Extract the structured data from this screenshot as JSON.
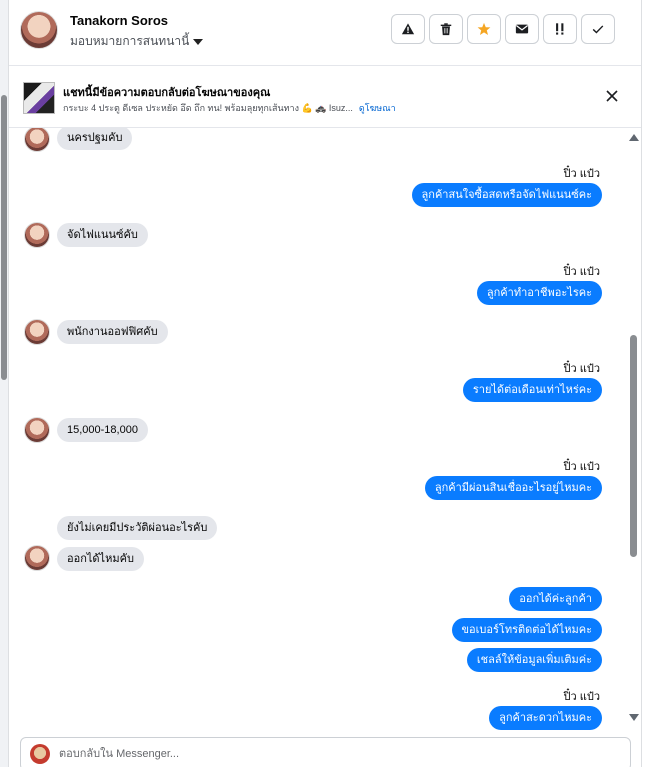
{
  "header": {
    "contact_name": "Tanakorn Soros",
    "assign_label": "มอบหมายการสนทนานี้",
    "actions": [
      {
        "name": "report-spam-button",
        "icon": "warning-icon"
      },
      {
        "name": "delete-button",
        "icon": "trash-icon"
      },
      {
        "name": "star-button",
        "icon": "star-icon"
      },
      {
        "name": "mark-unread-button",
        "icon": "envelope-icon"
      },
      {
        "name": "follow-up-button",
        "icon": "exclamation-icon"
      },
      {
        "name": "mark-done-button",
        "icon": "check-icon"
      }
    ],
    "star_color": "#f5a623"
  },
  "banner": {
    "title": "แชทนี้มีข้อความตอบกลับต่อโฆษณาของคุณ",
    "text": "กระบะ 4 ประตู ดีเซล ประหยัด อึด ถึก ทน! พร้อมลุยทุกเส้นทาง 💪 🚓 Isuz...",
    "link": "ดูโฆษณา"
  },
  "messages": {
    "in_1": "นครปฐมคับ",
    "sender_1": "ปิ๋ว แป๋ว",
    "out_1": "ลูกค้าสนใจซื้อสดหรือจัดไฟแนนซ์คะ",
    "in_2": "จัดไฟแนนซ์คับ",
    "sender_2": "ปิ๋ว แป๋ว",
    "out_2": "ลูกค้าทำอาชีพอะไรคะ",
    "in_3": "พนักงานออฟฟิศคับ",
    "sender_3": "ปิ๋ว แป๋ว",
    "out_3": "รายได้ต่อเดือนเท่าไหร่คะ",
    "in_4": "15,000-18,000",
    "sender_4": "ปิ๋ว แป๋ว",
    "out_4": "ลูกค้ามีผ่อนสินเชื่ออะไรอยู่ไหมคะ",
    "in_5": "ยังไม่เคยมีประวัติผ่อนอะไรคับ",
    "in_6": "ออกได้ไหมคับ",
    "out_5": "ออกได้ค่ะลูกค้า",
    "out_6": "ขอเบอร์โทรติดต่อได้ไหมคะ",
    "out_7": "เชลล์ให้ข้อมูลเพิ่มเติมค่ะ",
    "sender_5": "ปิ๋ว แป๋ว",
    "out_8": "ลูกค้าสะดวกไหมคะ"
  },
  "colors": {
    "outgoing_bubble": "#0a7cff",
    "incoming_bubble": "#e4e6eb",
    "link": "#0064d1"
  },
  "composer": {
    "placeholder": "ตอบกลับใน Messenger..."
  }
}
